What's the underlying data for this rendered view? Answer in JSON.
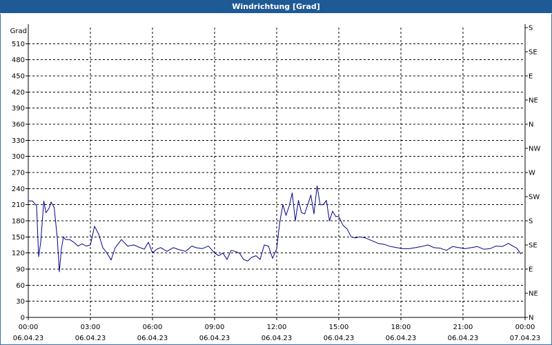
{
  "title": "Windrichtung [Grad]",
  "chart_data": {
    "type": "line",
    "title": "Windrichtung [Grad]",
    "ylabel": "Grad",
    "ylim": [
      0,
      540
    ],
    "yticks": [
      0,
      30,
      60,
      90,
      120,
      150,
      180,
      210,
      240,
      270,
      300,
      330,
      360,
      390,
      420,
      450,
      480,
      510
    ],
    "y2_ticks": [
      {
        "value": 0,
        "label": "N"
      },
      {
        "value": 45,
        "label": "NE"
      },
      {
        "value": 90,
        "label": "E"
      },
      {
        "value": 135,
        "label": "SE"
      },
      {
        "value": 180,
        "label": "S"
      },
      {
        "value": 225,
        "label": "SW"
      },
      {
        "value": 270,
        "label": "W"
      },
      {
        "value": 315,
        "label": "NW"
      },
      {
        "value": 360,
        "label": "N"
      },
      {
        "value": 405,
        "label": "NE"
      },
      {
        "value": 450,
        "label": "E"
      },
      {
        "value": 495,
        "label": "SE"
      },
      {
        "value": 540,
        "label": "S"
      }
    ],
    "xlim": [
      0,
      24
    ],
    "xticks": [
      {
        "value": 0,
        "time": "00:00",
        "date": "06.04.23"
      },
      {
        "value": 3,
        "time": "03:00",
        "date": "06.04.23"
      },
      {
        "value": 6,
        "time": "06:00",
        "date": "06.04.23"
      },
      {
        "value": 9,
        "time": "09:00",
        "date": "06.04.23"
      },
      {
        "value": 12,
        "time": "12:00",
        "date": "06.04.23"
      },
      {
        "value": 15,
        "time": "15:00",
        "date": "06.04.23"
      },
      {
        "value": 18,
        "time": "18:00",
        "date": "06.04.23"
      },
      {
        "value": 21,
        "time": "21:00",
        "date": "06.04.23"
      },
      {
        "value": 24,
        "time": "00:00",
        "date": "07.04.23"
      }
    ],
    "grid": true,
    "line_color": "#00008b",
    "series": [
      {
        "x": [
          0,
          0.2,
          0.4,
          0.5,
          0.6,
          0.75,
          0.85,
          1.0,
          1.1,
          1.25,
          1.4,
          1.5,
          1.6,
          1.7,
          1.8,
          2.0,
          2.2,
          2.4,
          2.6,
          2.8,
          3.0,
          3.2,
          3.4,
          3.6,
          3.8,
          4.0,
          4.2,
          4.5,
          4.8,
          5.1,
          5.4,
          5.6,
          5.8,
          6.0,
          6.2,
          6.4,
          6.7,
          7.0,
          7.3,
          7.6,
          7.9,
          8.1,
          8.4,
          8.7,
          9.0,
          9.2,
          9.4,
          9.6,
          9.8,
          10.0,
          10.2,
          10.4,
          10.6,
          10.8,
          11.0,
          11.2,
          11.4,
          11.6,
          11.8,
          12.0,
          12.15,
          12.3,
          12.45,
          12.6,
          12.75,
          12.9,
          13.05,
          13.2,
          13.35,
          13.5,
          13.65,
          13.8,
          13.95,
          14.1,
          14.25,
          14.4,
          14.55,
          14.7,
          14.85,
          15.0,
          15.2,
          15.4,
          15.6,
          15.8,
          16.0,
          16.3,
          16.6,
          16.9,
          17.2,
          17.5,
          17.8,
          18.1,
          18.4,
          18.7,
          19.0,
          19.3,
          19.6,
          19.9,
          20.2,
          20.5,
          20.8,
          21.1,
          21.4,
          21.7,
          22.0,
          22.3,
          22.6,
          22.9,
          23.2,
          23.4,
          23.6,
          23.8
        ],
        "y": [
          217,
          217,
          208,
          113,
          140,
          217,
          195,
          203,
          215,
          205,
          148,
          85,
          128,
          150,
          145,
          145,
          140,
          133,
          137,
          133,
          135,
          170,
          155,
          130,
          120,
          107,
          130,
          145,
          133,
          135,
          130,
          127,
          140,
          120,
          127,
          130,
          123,
          130,
          126,
          123,
          133,
          130,
          128,
          133,
          120,
          115,
          120,
          108,
          125,
          123,
          120,
          108,
          105,
          112,
          115,
          108,
          135,
          133,
          110,
          128,
          178,
          210,
          190,
          207,
          232,
          180,
          218,
          195,
          193,
          210,
          228,
          193,
          245,
          210,
          210,
          218,
          180,
          198,
          188,
          188,
          172,
          165,
          150,
          148,
          150,
          148,
          143,
          138,
          136,
          132,
          130,
          128,
          128,
          130,
          132,
          135,
          130,
          129,
          125,
          132,
          130,
          128,
          130,
          132,
          127,
          128,
          133,
          132,
          138,
          133,
          129,
          118
        ]
      }
    ]
  }
}
